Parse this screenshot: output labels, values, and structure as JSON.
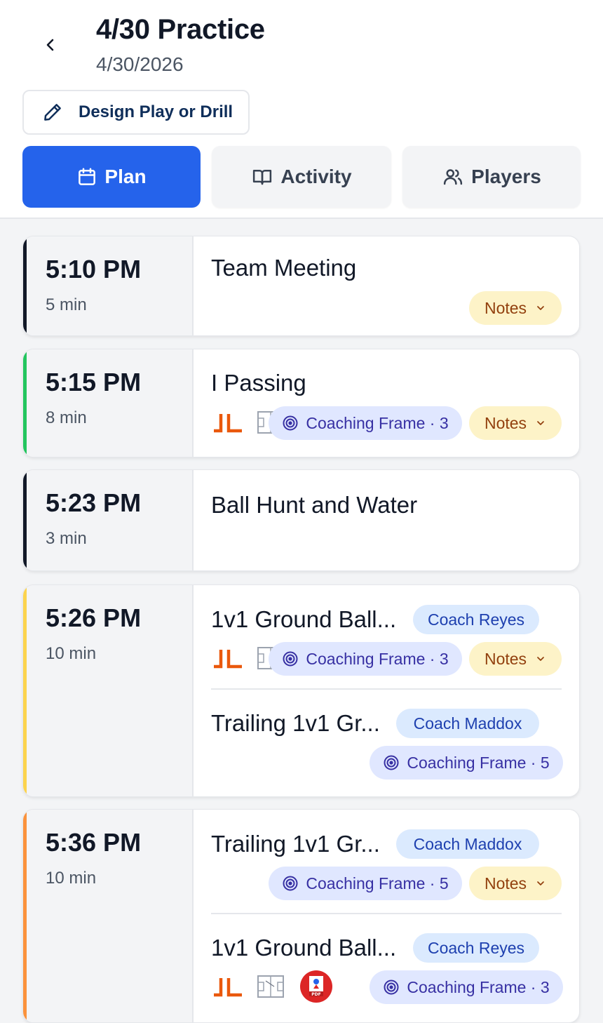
{
  "header": {
    "title": "4/30 Practice",
    "date": "4/30/2026",
    "back_icon": "chevron-left-icon",
    "design_button": {
      "label": "Design Play or Drill",
      "icon": "pencil-icon"
    }
  },
  "tabs": [
    {
      "label": "Plan",
      "icon": "calendar-icon",
      "active": true
    },
    {
      "label": "Activity",
      "icon": "book-icon",
      "active": false
    },
    {
      "label": "Players",
      "icon": "users-icon",
      "active": false
    }
  ],
  "colors": {
    "primary": "#2563eb",
    "notes_bg": "#fdf3c8",
    "notes_text": "#92400e",
    "frame_bg": "#e0e7ff",
    "frame_text": "#3730a3",
    "coach_bg": "#dbeafe",
    "coach_text": "#1e40af",
    "brand_orange": "#ea580c"
  },
  "schedule": [
    {
      "time": "5:10 PM",
      "duration": "5 min",
      "accent": "#111827",
      "activities": [
        {
          "title": "Team Meeting",
          "notes_label": "Notes"
        }
      ]
    },
    {
      "time": "5:15 PM",
      "duration": "8 min",
      "accent": "#22c55e",
      "activities": [
        {
          "title": "I Passing",
          "frame_label": "Coaching Frame · 3",
          "notes_label": "Notes"
        }
      ]
    },
    {
      "time": "5:23 PM",
      "duration": "3 min",
      "accent": "#111827",
      "activities": [
        {
          "title": "Ball Hunt and Water"
        }
      ]
    },
    {
      "time": "5:26 PM",
      "duration": "10 min",
      "accent": "#fcd34d",
      "activities": [
        {
          "title": "1v1 Ground Ball...",
          "coach": "Coach Reyes",
          "frame_label": "Coaching Frame · 3",
          "notes_label": "Notes"
        },
        {
          "title": "Trailing 1v1 Gr...",
          "coach": "Coach Maddox",
          "frame_label": "Coaching Frame · 5"
        }
      ]
    },
    {
      "time": "5:36 PM",
      "duration": "10 min",
      "accent": "#fb923c",
      "activities": [
        {
          "title": "Trailing 1v1 Gr...",
          "coach": "Coach Maddox",
          "frame_label": "Coaching Frame · 5",
          "notes_label": "Notes"
        },
        {
          "title": "1v1 Ground Ball...",
          "coach": "Coach Reyes",
          "frame_label": "Coaching Frame · 3"
        }
      ]
    }
  ]
}
